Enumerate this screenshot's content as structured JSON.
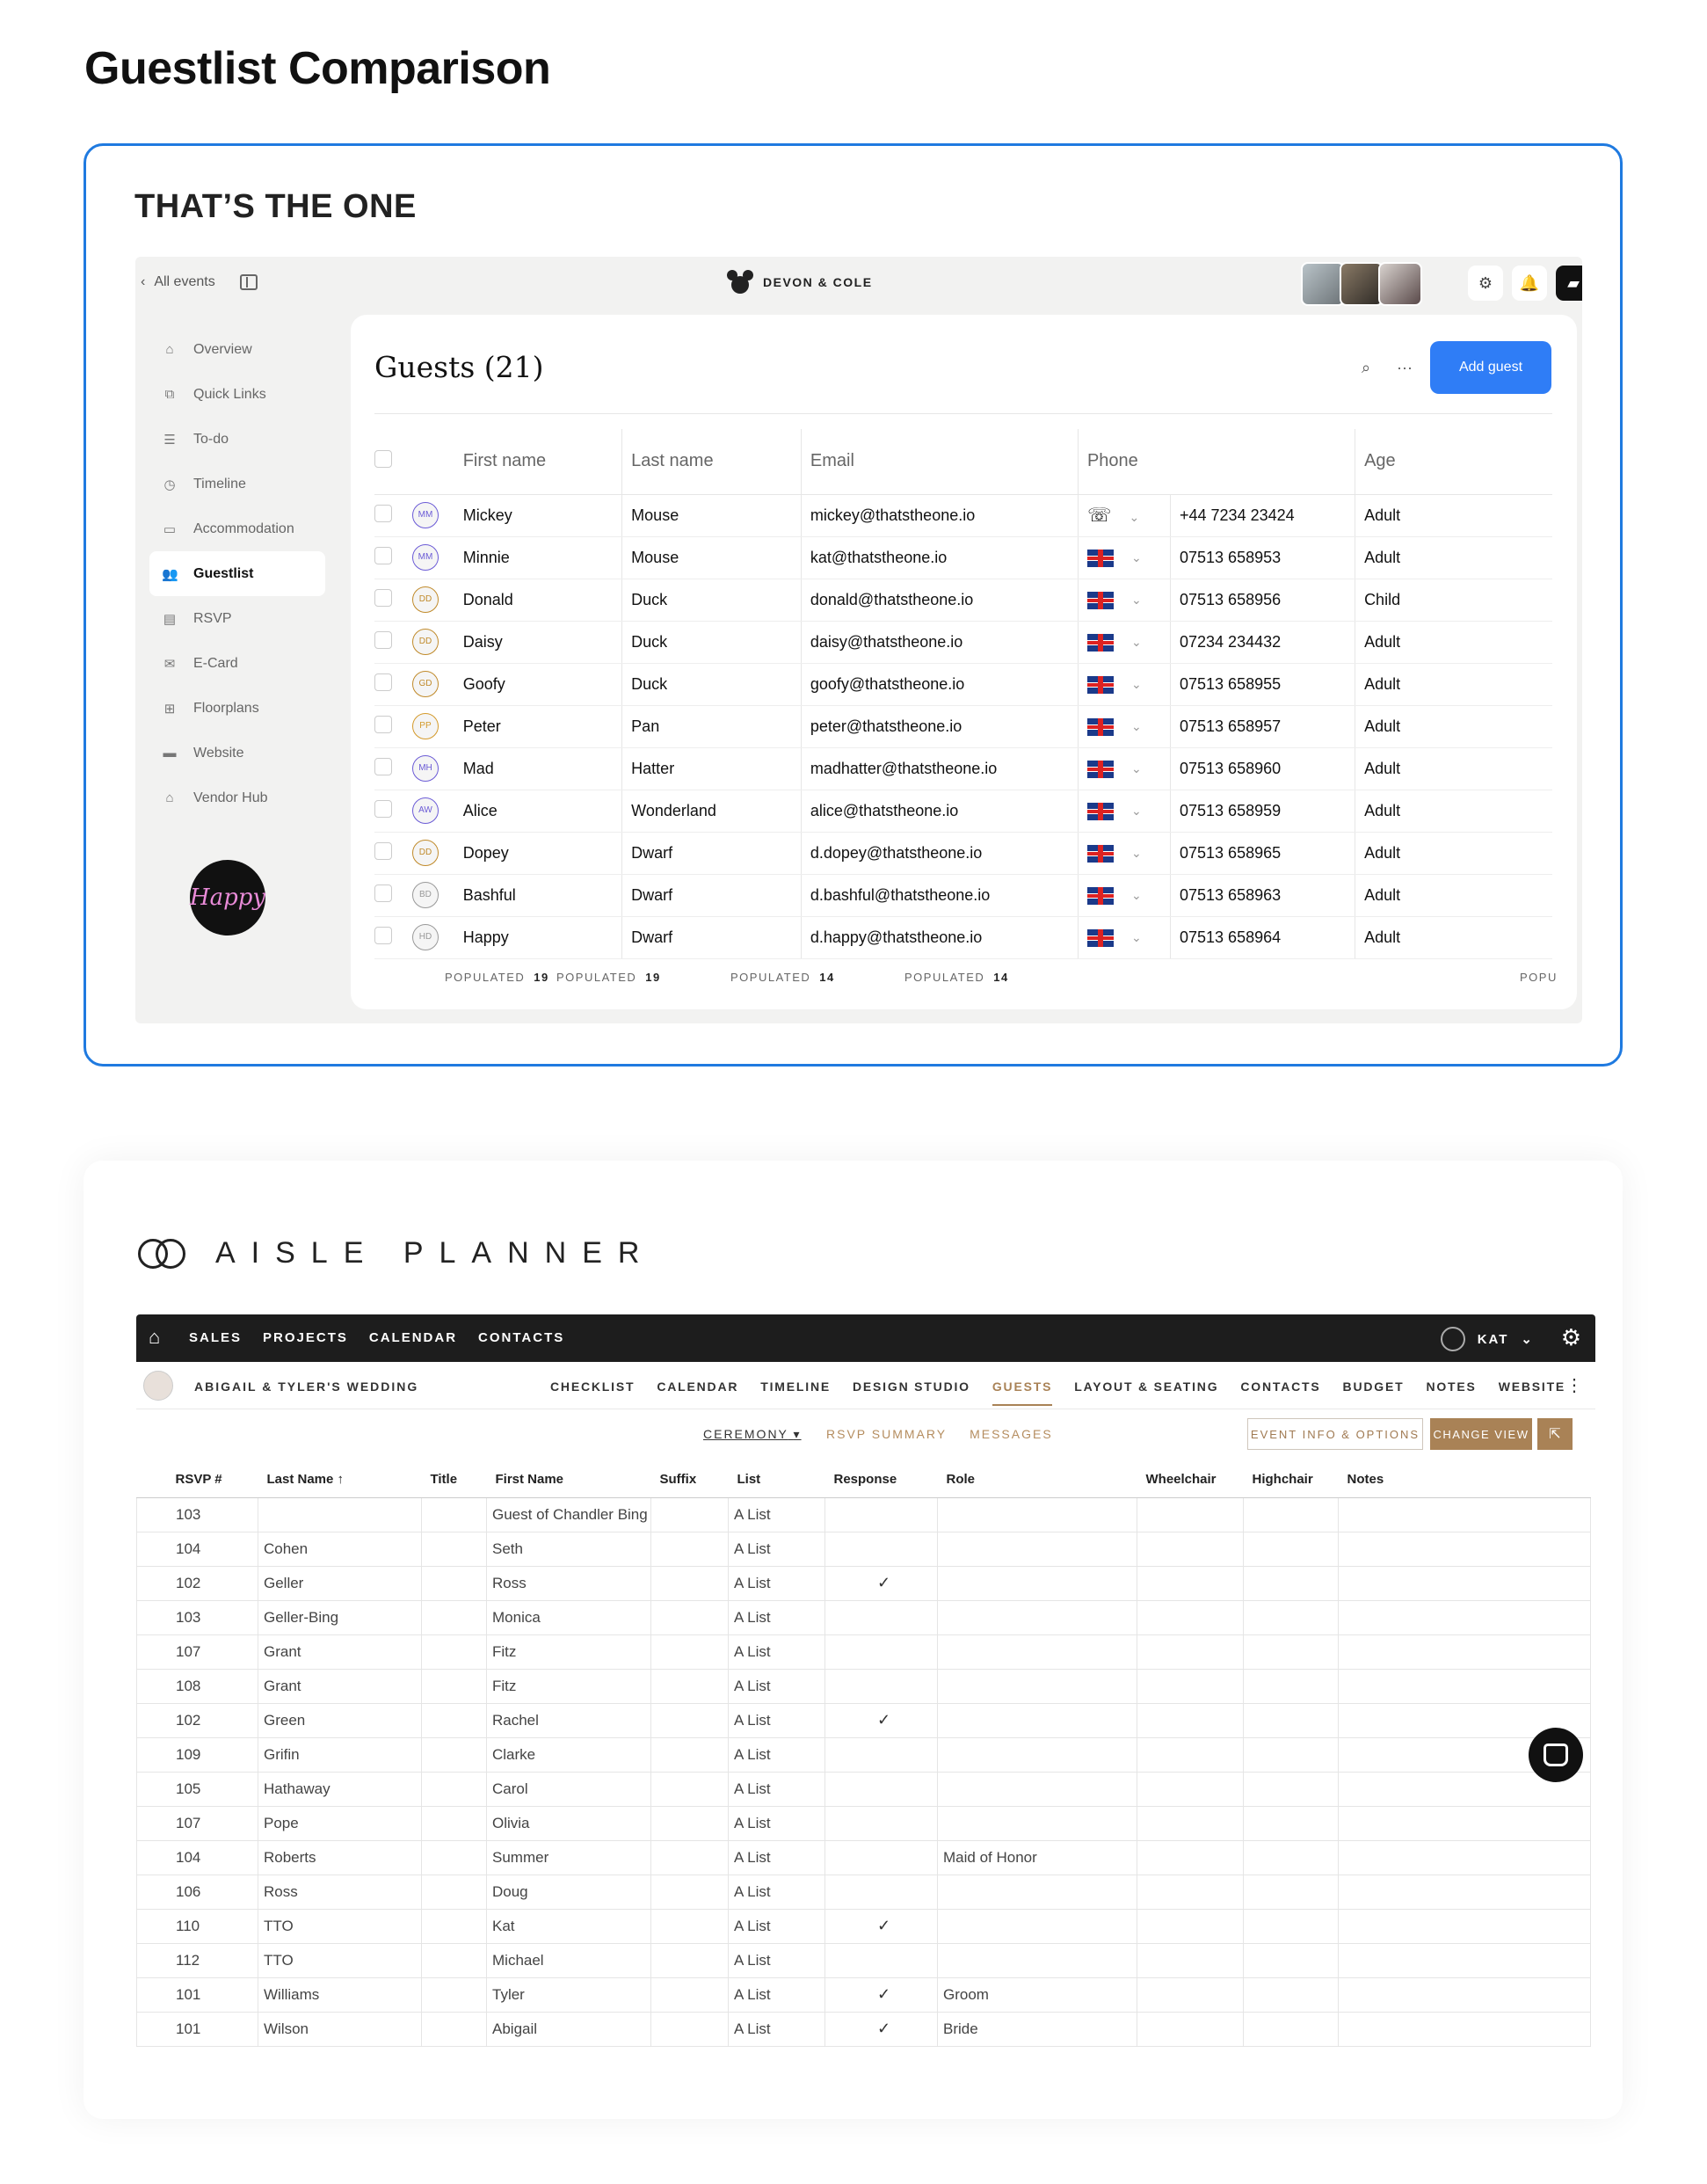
{
  "page_title": "Guestlist Comparison",
  "tto": {
    "brand": "THAT’S THE ONE",
    "topbar": {
      "back_label": "All events",
      "couple": "DEVON & COLE"
    },
    "sidebar": [
      {
        "label": "Overview",
        "icon": "home-icon",
        "glyph": "⌂"
      },
      {
        "label": "Quick Links",
        "icon": "link-icon",
        "glyph": "⧉"
      },
      {
        "label": "To-do",
        "icon": "list-icon",
        "glyph": "☰"
      },
      {
        "label": "Timeline",
        "icon": "clock-icon",
        "glyph": "◷"
      },
      {
        "label": "Accommodation",
        "icon": "bed-icon",
        "glyph": "▭"
      },
      {
        "label": "Guestlist",
        "icon": "users-icon",
        "glyph": "👥"
      },
      {
        "label": "RSVP",
        "icon": "form-icon",
        "glyph": "▤"
      },
      {
        "label": "E-Card",
        "icon": "mail-icon",
        "glyph": "✉"
      },
      {
        "label": "Floorplans",
        "icon": "floorplan-icon",
        "glyph": "⊞"
      },
      {
        "label": "Website",
        "icon": "laptop-icon",
        "glyph": "▬"
      },
      {
        "label": "Vendor Hub",
        "icon": "store-icon",
        "glyph": "⌂"
      }
    ],
    "active_sidebar": "Guestlist",
    "logo_text": "Happy",
    "main": {
      "title": "Guests (21)",
      "add_button": "Add guest",
      "columns": [
        "First name",
        "Last name",
        "Email",
        "Phone",
        "Age"
      ],
      "rows": [
        {
          "ini": "MM",
          "first": "Mickey",
          "last": "Mouse",
          "email": "mickey@thatstheone.io",
          "flag": "globe",
          "phone": "+44 7234 23424",
          "age": "Adult"
        },
        {
          "ini": "MM",
          "first": "Minnie",
          "last": "Mouse",
          "email": "kat@thatstheone.io",
          "flag": "uk",
          "phone": "07513 658953",
          "age": "Adult"
        },
        {
          "ini": "DD",
          "first": "Donald",
          "last": "Duck",
          "email": "donald@thatstheone.io",
          "flag": "uk",
          "phone": "07513 658956",
          "age": "Child"
        },
        {
          "ini": "DD",
          "first": "Daisy",
          "last": "Duck",
          "email": "daisy@thatstheone.io",
          "flag": "uk",
          "phone": "07234 234432",
          "age": "Adult"
        },
        {
          "ini": "GD",
          "first": "Goofy",
          "last": "Duck",
          "email": "goofy@thatstheone.io",
          "flag": "uk",
          "phone": "07513 658955",
          "age": "Adult"
        },
        {
          "ini": "PP",
          "first": "Peter",
          "last": "Pan",
          "email": "peter@thatstheone.io",
          "flag": "uk",
          "phone": "07513 658957",
          "age": "Adult"
        },
        {
          "ini": "MH",
          "first": "Mad",
          "last": "Hatter",
          "email": "madhatter@thatstheone.io",
          "flag": "uk",
          "phone": "07513 658960",
          "age": "Adult"
        },
        {
          "ini": "AW",
          "first": "Alice",
          "last": "Wonderland",
          "email": "alice@thatstheone.io",
          "flag": "uk",
          "phone": "07513 658959",
          "age": "Adult"
        },
        {
          "ini": "DD",
          "first": "Dopey",
          "last": "Dwarf",
          "email": "d.dopey@thatstheone.io",
          "flag": "uk",
          "phone": "07513 658965",
          "age": "Adult"
        },
        {
          "ini": "BD",
          "first": "Bashful",
          "last": "Dwarf",
          "email": "d.bashful@thatstheone.io",
          "flag": "uk",
          "phone": "07513 658963",
          "age": "Adult"
        },
        {
          "ini": "HD",
          "first": "Happy",
          "last": "Dwarf",
          "email": "d.happy@thatstheone.io",
          "flag": "uk",
          "phone": "07513 658964",
          "age": "Adult"
        }
      ],
      "populated_label": "POPULATED",
      "populated": [
        "19",
        "19",
        "14",
        "14"
      ],
      "populated_tail": "POPU"
    }
  },
  "aisle": {
    "brand": "AISLE PLANNER",
    "nav": [
      "SALES",
      "PROJECTS",
      "CALENDAR",
      "CONTACTS"
    ],
    "user": "KAT",
    "wedding": "ABIGAIL & TYLER'S WEDDING",
    "tabs": [
      "CHECKLIST",
      "CALENDAR",
      "TIMELINE",
      "DESIGN STUDIO",
      "GUESTS",
      "LAYOUT & SEATING",
      "CONTACTS",
      "BUDGET",
      "NOTES",
      "WEBSITE"
    ],
    "active_tab": "GUESTS",
    "ceremony": "CEREMONY",
    "tool_links": [
      "RSVP SUMMARY",
      "MESSAGES"
    ],
    "event_info_button": "EVENT INFO & OPTIONS",
    "change_view_button": "CHANGE VIEW",
    "columns": [
      "RSVP #",
      "Last Name ↑",
      "Title",
      "First Name",
      "Suffix",
      "List",
      "Response",
      "Role",
      "Wheelchair",
      "Highchair",
      "Notes"
    ],
    "rows": [
      [
        "103",
        "",
        "",
        "Guest of Chandler Bing",
        "",
        "A List",
        "",
        "",
        "",
        "",
        ""
      ],
      [
        "104",
        "Cohen",
        "",
        "Seth",
        "",
        "A List",
        "",
        "",
        "",
        "",
        ""
      ],
      [
        "102",
        "Geller",
        "",
        "Ross",
        "",
        "A List",
        "✓",
        "",
        "",
        "",
        ""
      ],
      [
        "103",
        "Geller-Bing",
        "",
        "Monica",
        "",
        "A List",
        "",
        "",
        "",
        "",
        ""
      ],
      [
        "107",
        "Grant",
        "",
        "Fitz",
        "",
        "A List",
        "",
        "",
        "",
        "",
        ""
      ],
      [
        "108",
        "Grant",
        "",
        "Fitz",
        "",
        "A List",
        "",
        "",
        "",
        "",
        ""
      ],
      [
        "102",
        "Green",
        "",
        "Rachel",
        "",
        "A List",
        "✓",
        "",
        "",
        "",
        ""
      ],
      [
        "109",
        "Grifin",
        "",
        "Clarke",
        "",
        "A List",
        "",
        "",
        "",
        "",
        ""
      ],
      [
        "105",
        "Hathaway",
        "",
        "Carol",
        "",
        "A List",
        "",
        "",
        "",
        "",
        ""
      ],
      [
        "107",
        "Pope",
        "",
        "Olivia",
        "",
        "A List",
        "",
        "",
        "",
        "",
        ""
      ],
      [
        "104",
        "Roberts",
        "",
        "Summer",
        "",
        "A List",
        "",
        "Maid of Honor",
        "",
        "",
        ""
      ],
      [
        "106",
        "Ross",
        "",
        "Doug",
        "",
        "A List",
        "",
        "",
        "",
        "",
        ""
      ],
      [
        "110",
        "TTO",
        "",
        "Kat",
        "",
        "A List",
        "✓",
        "",
        "",
        "",
        ""
      ],
      [
        "112",
        "TTO",
        "",
        "Michael",
        "",
        "A List",
        "",
        "",
        "",
        "",
        ""
      ],
      [
        "101",
        "Williams",
        "",
        "Tyler",
        "",
        "A List",
        "✓",
        "Groom",
        "",
        "",
        ""
      ],
      [
        "101",
        "Wilson",
        "",
        "Abigail",
        "",
        "A List",
        "✓",
        "Bride",
        "",
        "",
        ""
      ]
    ]
  }
}
